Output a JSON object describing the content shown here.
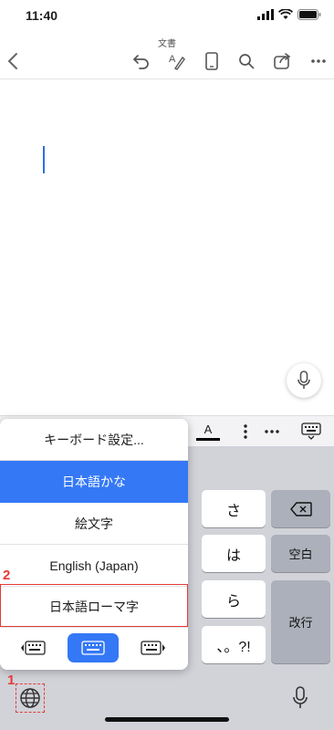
{
  "status_bar": {
    "time": "11:40"
  },
  "document": {
    "title": "文書"
  },
  "toolbar": {
    "back_icon": "chevron-left-icon",
    "undo_icon": "undo-icon",
    "pen_icon": "pen-icon",
    "phone_view_icon": "phone-icon",
    "search_icon": "search-icon",
    "share_icon": "share-icon",
    "more_icon": "more-icon"
  },
  "format_bar": {
    "font_color_label": "A",
    "font_color": "#000000"
  },
  "keyboard": {
    "keys": {
      "sa": "さ",
      "ha": "は",
      "ra": "ら",
      "punct": "、。?!",
      "space": "空白",
      "return": "改行"
    }
  },
  "keyboard_menu": {
    "items": [
      {
        "label": "キーボード設定...",
        "selected": false
      },
      {
        "label": "日本語かな",
        "selected": true
      },
      {
        "label": "絵文字",
        "selected": false
      },
      {
        "label": "English (Japan)",
        "selected": false
      },
      {
        "label": "日本語ローマ字",
        "selected": false
      }
    ],
    "layouts": [
      "keyboard-left-icon",
      "keyboard-full-icon",
      "keyboard-right-icon"
    ],
    "active_layout": 1
  },
  "annotations": {
    "marker1": "1",
    "marker2": "2",
    "color": "#e53935"
  },
  "colors": {
    "accent": "#3478f6",
    "caret": "#2f6fe0"
  }
}
